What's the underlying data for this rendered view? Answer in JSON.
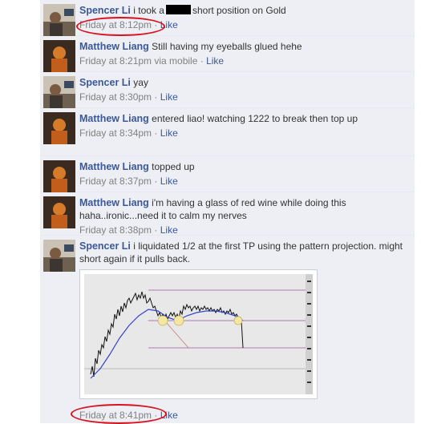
{
  "comments": [
    {
      "author": "Spencer Li",
      "text_before": "i took a",
      "text_after": "short position on Gold",
      "time": "Friday at 8:12pm",
      "via": "",
      "like": "Like"
    },
    {
      "author": "Matthew Liang",
      "text": "Still having my eyeballs glued hehe",
      "time": "Friday at 8:21pm via mobile",
      "like": "Like"
    },
    {
      "author": "Spencer Li",
      "text": "yay",
      "time": "Friday at 8:30pm",
      "like": "Like"
    },
    {
      "author": "Matthew Liang",
      "text": "entered liao! watching 1222 to break then top up",
      "time": "Friday at 8:34pm",
      "like": "Like"
    },
    {
      "author": "Matthew Liang",
      "text": "topped up",
      "time": "Friday at 8:37pm",
      "like": "Like"
    },
    {
      "author": "Matthew Liang",
      "text": "i'm having a glass of red wine while doing this haha..ironic...need it to calm my nerves",
      "time": "Friday at 8:38pm",
      "like": "Like"
    },
    {
      "author": "Spencer Li",
      "text": "i liquidated 1/2 at the first TP using the pattern projection. might short again if it pulls back.",
      "time": "Friday at 8:41pm",
      "like": "Like"
    }
  ],
  "separator": "·",
  "colors": {
    "link": "#3b5998",
    "meta": "#808080",
    "comment_bg": "#edeff4",
    "annotation": "#d8111f"
  },
  "icons": [
    "profile-photo",
    "chart-screenshot"
  ]
}
